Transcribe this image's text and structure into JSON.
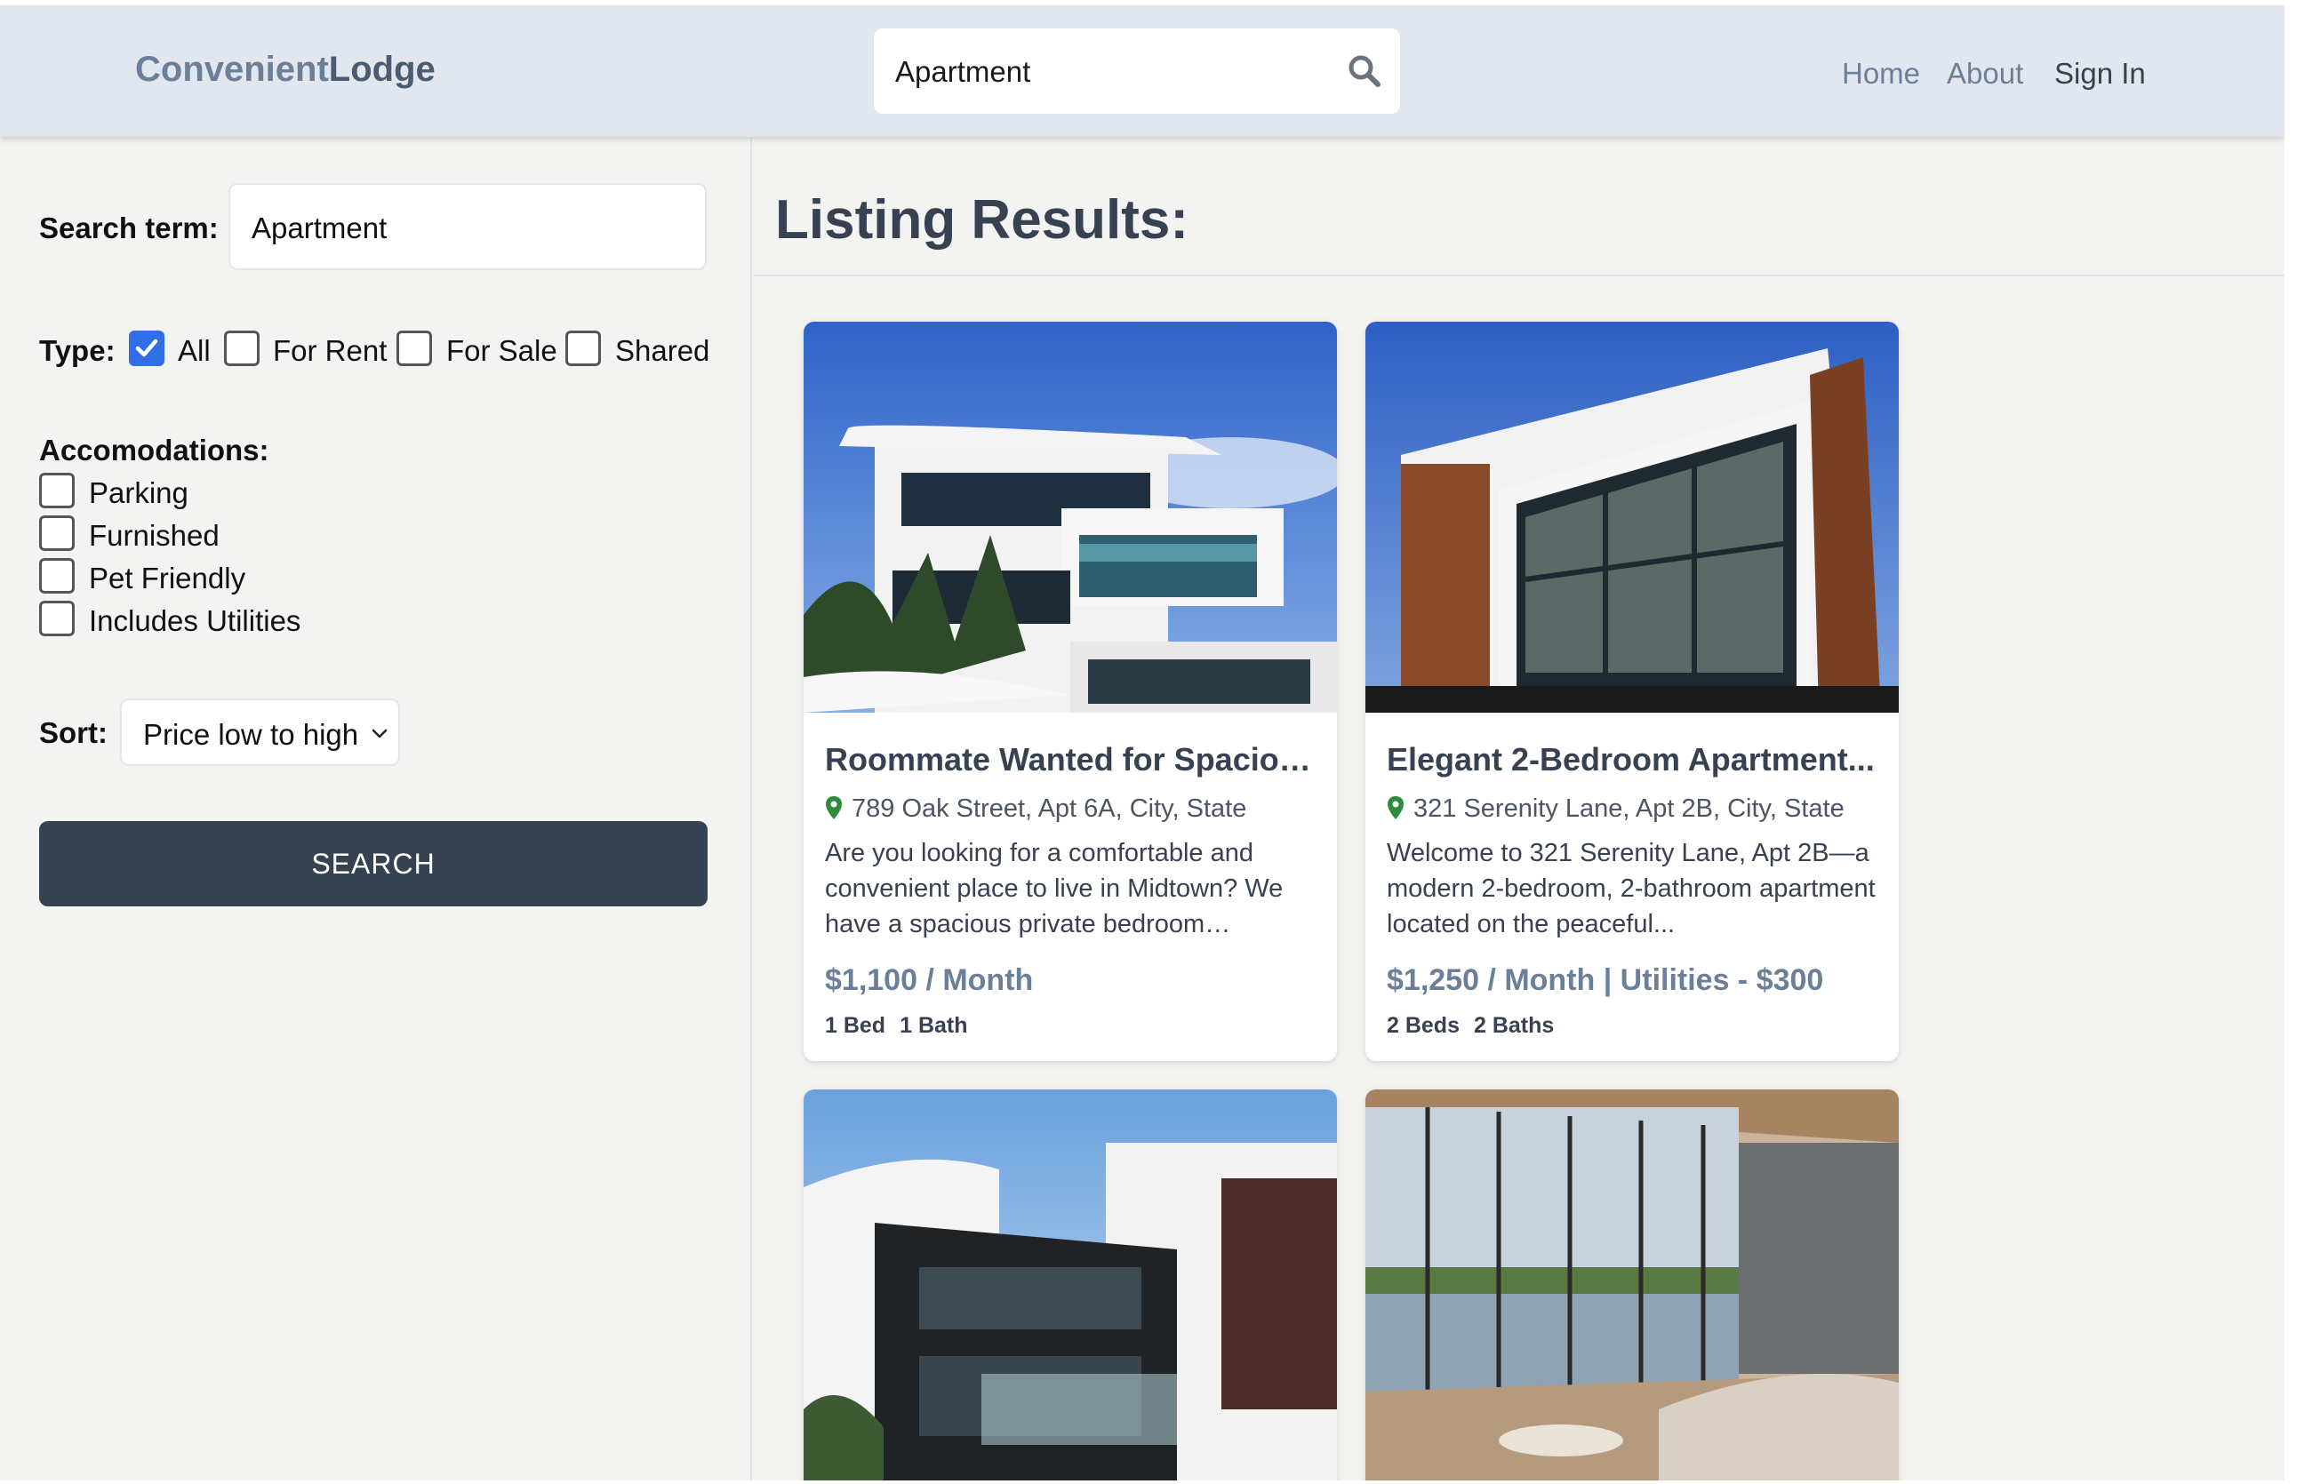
{
  "header": {
    "logo_light": "Convenient",
    "logo_bold": "Lodge",
    "search_value": "Apartment",
    "nav": {
      "home": "Home",
      "about": "About",
      "sign_in": "Sign In"
    }
  },
  "filters": {
    "search_label": "Search term:",
    "search_value": "Apartment",
    "type_label": "Type:",
    "types": [
      {
        "label": "All",
        "checked": true
      },
      {
        "label": "For Rent",
        "checked": false
      },
      {
        "label": "For Sale",
        "checked": false
      },
      {
        "label": "Shared",
        "checked": false
      }
    ],
    "accommodations_label": "Accomodations:",
    "accommodations": [
      {
        "label": "Parking",
        "checked": false
      },
      {
        "label": "Furnished",
        "checked": false
      },
      {
        "label": "Pet Friendly",
        "checked": false
      },
      {
        "label": "Includes Utilities",
        "checked": false
      }
    ],
    "sort_label": "Sort:",
    "sort_value": "Price low to high",
    "search_button": "SEARCH"
  },
  "results": {
    "title": "Listing Results:",
    "listings": [
      {
        "title": "Roommate Wanted for Spaciou...",
        "address": "789 Oak Street, Apt 6A, City, State",
        "description": "Are you looking for a comfortable and convenient place to live in Midtown? We have a spacious private bedroom availabl...",
        "price": "$1,100 / Month",
        "beds": "1 Bed",
        "baths": "1 Bath"
      },
      {
        "title": "Elegant 2-Bedroom Apartment...",
        "address": "321 Serenity Lane, Apt 2B, City, State",
        "description": "Welcome to 321 Serenity Lane, Apt 2B—a modern 2-bedroom, 2-bathroom apartment located on the peaceful...",
        "price": "$1,250 / Month | Utilities - $300",
        "beds": "2 Beds",
        "baths": "2 Baths"
      }
    ]
  },
  "colors": {
    "header_bg": "#e2e6ee",
    "accent": "#6b7f99",
    "button_bg": "#364152",
    "checkbox_checked": "#2f6ee6",
    "pin": "#2e8b3e"
  }
}
